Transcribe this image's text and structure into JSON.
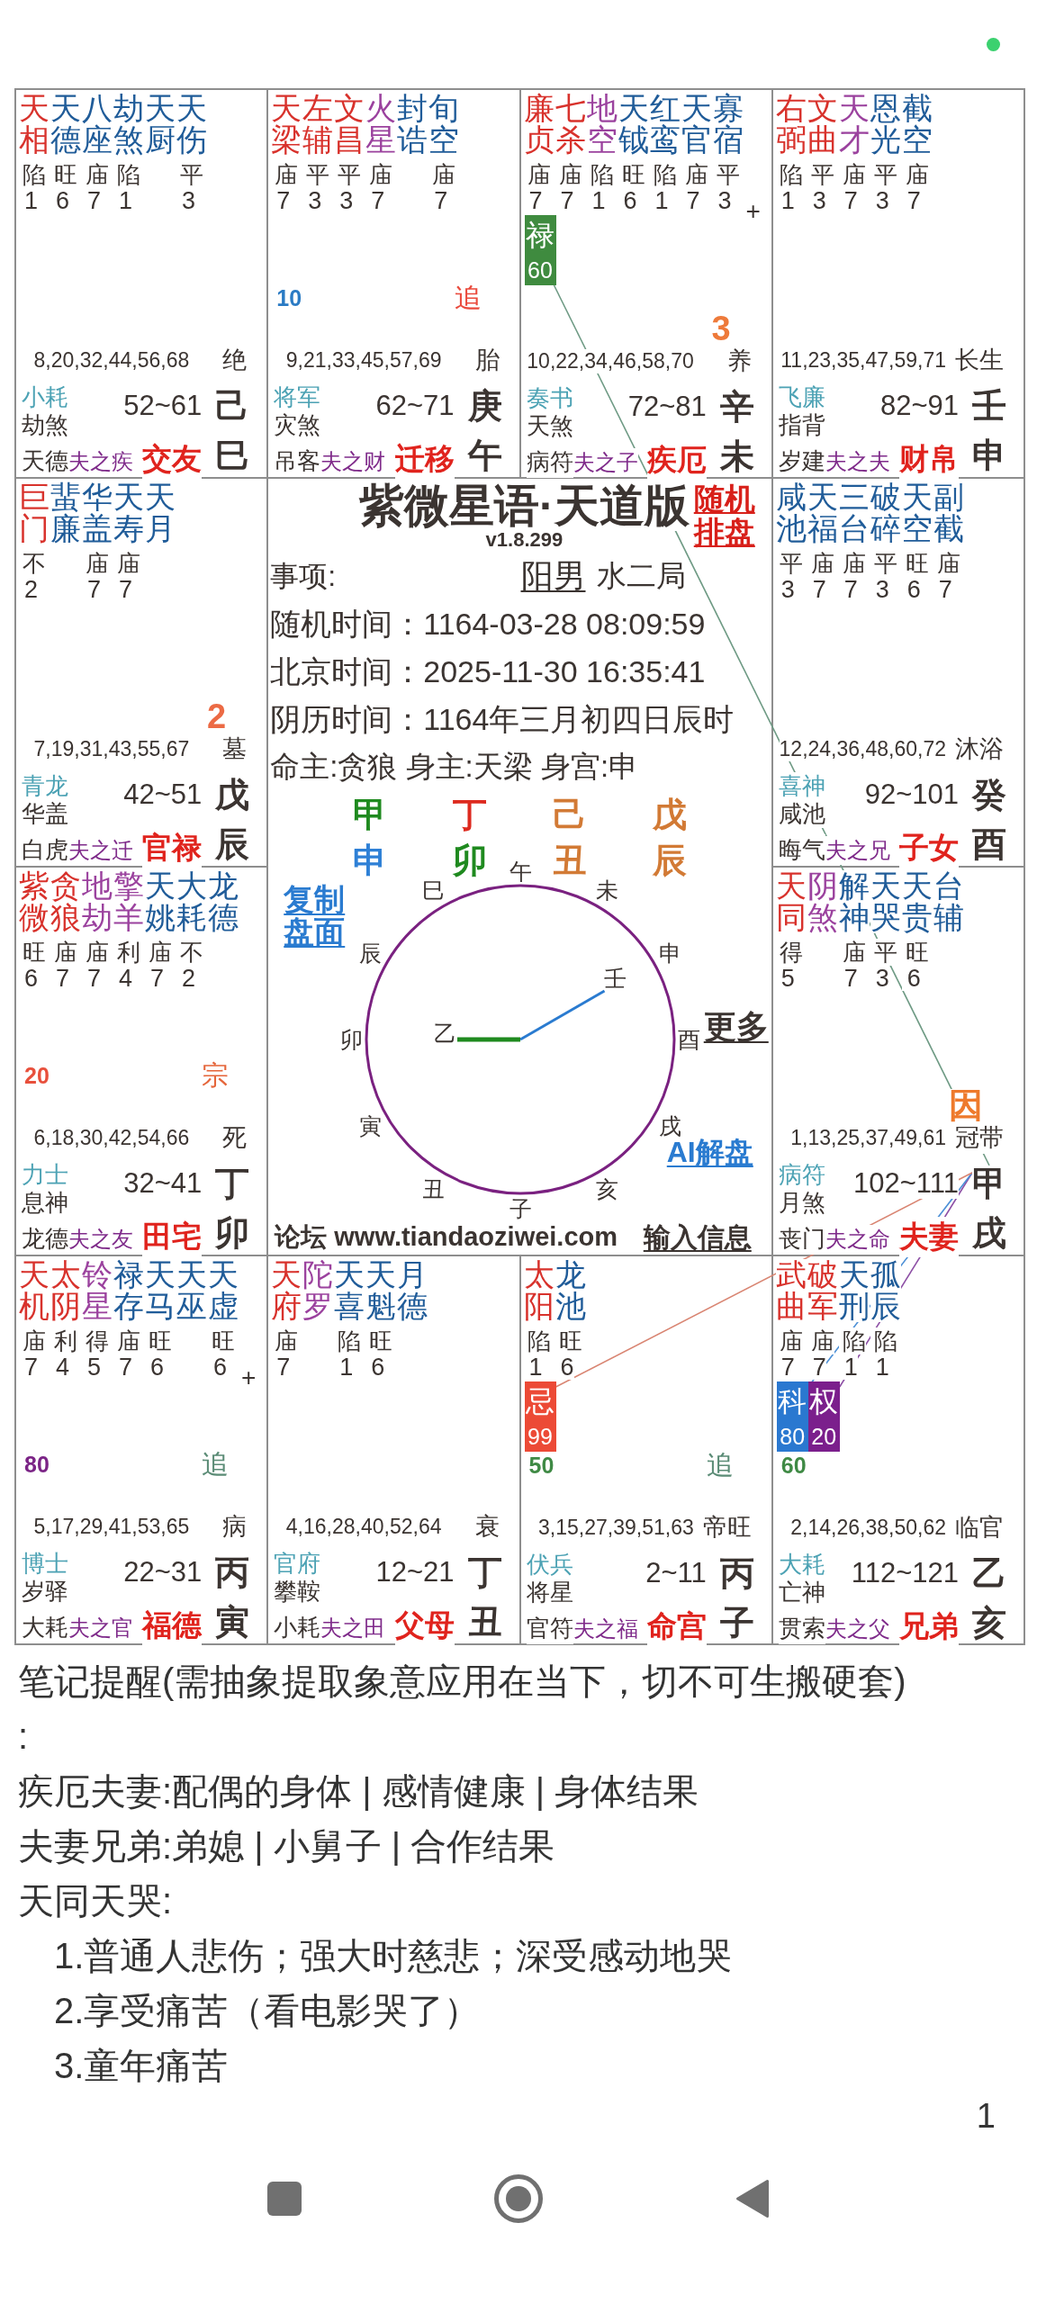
{
  "palaces": [
    {
      "stars": [
        {
          "name": "天相",
          "kind": "major",
          "brightness": "陷",
          "score": "1"
        },
        {
          "name": "天德",
          "kind": "minor",
          "brightness": "旺",
          "score": "6"
        },
        {
          "name": "八座",
          "kind": "minor",
          "brightness": "庙",
          "score": "7"
        },
        {
          "name": "劫煞",
          "kind": "minor",
          "brightness": "陷",
          "score": "1"
        },
        {
          "name": "天厨",
          "kind": "minor"
        },
        {
          "name": "天伤",
          "kind": "minor",
          "brightness": "平",
          "score": "3"
        }
      ],
      "ages": "8,20,32,44,56,68",
      "stage": "绝",
      "boshi": "小耗",
      "jiangqian": "劫煞",
      "suiqian": "天德",
      "relation": "夫之疾",
      "name": "交友",
      "range": "52~61",
      "stem": "己",
      "branch": "巳"
    },
    {
      "stars": [
        {
          "name": "天梁",
          "kind": "major",
          "brightness": "庙",
          "score": "7"
        },
        {
          "name": "左辅",
          "kind": "major",
          "brightness": "平",
          "score": "3"
        },
        {
          "name": "文昌",
          "kind": "major",
          "brightness": "平",
          "score": "3"
        },
        {
          "name": "火星",
          "kind": "malefic",
          "brightness": "庙",
          "score": "7"
        },
        {
          "name": "封诰",
          "kind": "minor"
        },
        {
          "name": "旬空",
          "kind": "minor",
          "brightness": "庙",
          "score": "7"
        }
      ],
      "count": {
        "text": "10",
        "color": "#2b7bc4"
      },
      "tag": {
        "text": "追",
        "color": "#ea4a3c"
      },
      "ages": "9,21,33,45,57,69",
      "stage": "胎",
      "boshi": "将军",
      "jiangqian": "灾煞",
      "suiqian": "吊客",
      "relation": "夫之财",
      "name": "迁移",
      "range": "62~71",
      "stem": "庚",
      "branch": "午"
    },
    {
      "stars": [
        {
          "name": "廉贞",
          "kind": "major",
          "brightness": "庙",
          "score": "7"
        },
        {
          "name": "七杀",
          "kind": "major",
          "brightness": "庙",
          "score": "7"
        },
        {
          "name": "地空",
          "kind": "malefic",
          "brightness": "陷",
          "score": "1"
        },
        {
          "name": "天钺",
          "kind": "minor",
          "brightness": "旺",
          "score": "6"
        },
        {
          "name": "红鸾",
          "kind": "minor",
          "brightness": "陷",
          "score": "1"
        },
        {
          "name": "天官",
          "kind": "minor",
          "brightness": "庙",
          "score": "7"
        },
        {
          "name": "寡宿",
          "kind": "minor",
          "brightness": "平",
          "score": "3"
        }
      ],
      "plus_mark": "+",
      "sihua": [
        {
          "label": "禄",
          "value": "60",
          "kind": "lu"
        }
      ],
      "big": {
        "text": "3",
        "color": "#ee7a3a"
      },
      "ages": "10,22,34,46,58,70",
      "stage": "养",
      "boshi": "奏书",
      "jiangqian": "天煞",
      "suiqian": "病符",
      "relation": "夫之子",
      "name": "疾厄",
      "range": "72~81",
      "stem": "辛",
      "branch": "未"
    },
    {
      "stars": [
        {
          "name": "右弼",
          "kind": "major",
          "brightness": "陷",
          "score": "1"
        },
        {
          "name": "文曲",
          "kind": "major",
          "brightness": "平",
          "score": "3"
        },
        {
          "name": "天才",
          "kind": "malefic",
          "brightness": "庙",
          "score": "7"
        },
        {
          "name": "恩光",
          "kind": "minor",
          "brightness": "平",
          "score": "3"
        },
        {
          "name": "截空",
          "kind": "minor",
          "brightness": "庙",
          "score": "7"
        }
      ],
      "ages": "11,23,35,47,59,71",
      "stage": "长生",
      "boshi": "飞廉",
      "jiangqian": "指背",
      "suiqian": "岁建",
      "relation": "夫之夫",
      "name": "财帛",
      "range": "82~91",
      "stem": "壬",
      "branch": "申"
    },
    {
      "stars": [
        {
          "name": "巨门",
          "kind": "major",
          "brightness": "不",
          "score": "2"
        },
        {
          "name": "蜚廉",
          "kind": "minor"
        },
        {
          "name": "华盖",
          "kind": "minor",
          "brightness": "庙",
          "score": "7"
        },
        {
          "name": "天寿",
          "kind": "minor",
          "brightness": "庙",
          "score": "7"
        },
        {
          "name": "天月",
          "kind": "minor"
        }
      ],
      "big": {
        "text": "2",
        "color": "#ec6a44"
      },
      "ages": "7,19,31,43,55,67",
      "stage": "墓",
      "boshi": "青龙",
      "jiangqian": "华盖",
      "suiqian": "白虎",
      "relation": "夫之迁",
      "name": "官禄",
      "range": "42~51",
      "stem": "戊",
      "branch": "辰"
    },
    {
      "stars": [
        {
          "name": "咸池",
          "kind": "minor",
          "brightness": "平",
          "score": "3"
        },
        {
          "name": "天福",
          "kind": "minor",
          "brightness": "庙",
          "score": "7"
        },
        {
          "name": "三台",
          "kind": "minor",
          "brightness": "庙",
          "score": "7"
        },
        {
          "name": "破碎",
          "kind": "minor",
          "brightness": "平",
          "score": "3"
        },
        {
          "name": "天空",
          "kind": "minor",
          "brightness": "旺",
          "score": "6"
        },
        {
          "name": "副截",
          "kind": "minor",
          "brightness": "庙",
          "score": "7"
        }
      ],
      "ages": "12,24,36,48,60,72",
      "stage": "沐浴",
      "boshi": "喜神",
      "jiangqian": "咸池",
      "suiqian": "晦气",
      "relation": "夫之兄",
      "name": "子女",
      "range": "92~101",
      "stem": "癸",
      "branch": "酉"
    },
    {
      "stars": [
        {
          "name": "紫微",
          "kind": "major",
          "brightness": "旺",
          "score": "6"
        },
        {
          "name": "贪狼",
          "kind": "major",
          "brightness": "庙",
          "score": "7"
        },
        {
          "name": "地劫",
          "kind": "malefic",
          "brightness": "庙",
          "score": "7"
        },
        {
          "name": "擎羊",
          "kind": "malefic",
          "brightness": "利",
          "score": "4"
        },
        {
          "name": "天姚",
          "kind": "minor",
          "brightness": "庙",
          "score": "7"
        },
        {
          "name": "大耗",
          "kind": "minor",
          "brightness": "不",
          "score": "2"
        },
        {
          "name": "龙德",
          "kind": "minor"
        }
      ],
      "count": {
        "text": "20",
        "color": "#e8503c"
      },
      "tag": {
        "text": "宗",
        "color": "#e5653a"
      },
      "ages": "6,18,30,42,54,66",
      "stage": "死",
      "boshi": "力士",
      "jiangqian": "息神",
      "suiqian": "龙德",
      "relation": "夫之友",
      "name": "田宅",
      "range": "32~41",
      "stem": "丁",
      "branch": "卯"
    },
    {
      "stars": [
        {
          "name": "天同",
          "kind": "major",
          "brightness": "得",
          "score": "5"
        },
        {
          "name": "阴煞",
          "kind": "malefic"
        },
        {
          "name": "解神",
          "kind": "minor",
          "brightness": "庙",
          "score": "7"
        },
        {
          "name": "天哭",
          "kind": "minor",
          "brightness": "平",
          "score": "3"
        },
        {
          "name": "天贵",
          "kind": "minor",
          "brightness": "旺",
          "score": "6"
        },
        {
          "name": "台辅",
          "kind": "minor"
        }
      ],
      "big": {
        "text": "因",
        "color": "#ee7a2c"
      },
      "ages": "1,13,25,37,49,61",
      "stage": "冠带",
      "boshi": "病符",
      "jiangqian": "月煞",
      "suiqian": "丧门",
      "relation": "夫之命",
      "name": "夫妻",
      "range": "102~111",
      "stem": "甲",
      "branch": "戌",
      "flying": [
        {
          "kind": "lu"
        },
        {
          "kind": "quan"
        },
        {
          "kind": "ke"
        },
        {
          "kind": "ji"
        }
      ]
    },
    {
      "stars": [
        {
          "name": "天机",
          "kind": "major",
          "brightness": "庙",
          "score": "7"
        },
        {
          "name": "太阴",
          "kind": "major",
          "brightness": "利",
          "score": "4"
        },
        {
          "name": "铃星",
          "kind": "malefic",
          "brightness": "得",
          "score": "5"
        },
        {
          "name": "禄存",
          "kind": "minor",
          "brightness": "庙",
          "score": "7"
        },
        {
          "name": "天马",
          "kind": "minor",
          "brightness": "旺",
          "score": "6"
        },
        {
          "name": "天巫",
          "kind": "minor"
        },
        {
          "name": "天虚",
          "kind": "minor",
          "brightness": "旺",
          "score": "6"
        }
      ],
      "plus_mark": "+",
      "count": {
        "text": "80",
        "color": "#7b2486"
      },
      "tag": {
        "text": "追",
        "color": "#5b8c76"
      },
      "ages": "5,17,29,41,53,65",
      "stage": "病",
      "boshi": "博士",
      "jiangqian": "岁驿",
      "suiqian": "大耗",
      "relation": "夫之官",
      "name": "福德",
      "range": "22~31",
      "stem": "丙",
      "branch": "寅"
    },
    {
      "stars": [
        {
          "name": "天府",
          "kind": "major",
          "brightness": "庙",
          "score": "7"
        },
        {
          "name": "陀罗",
          "kind": "malefic"
        },
        {
          "name": "天喜",
          "kind": "minor",
          "brightness": "陷",
          "score": "1"
        },
        {
          "name": "天魁",
          "kind": "minor",
          "brightness": "旺",
          "score": "6"
        },
        {
          "name": "月德",
          "kind": "minor"
        }
      ],
      "ages": "4,16,28,40,52,64",
      "stage": "衰",
      "boshi": "官府",
      "jiangqian": "攀鞍",
      "suiqian": "小耗",
      "relation": "夫之田",
      "name": "父母",
      "range": "12~21",
      "stem": "丁",
      "branch": "丑"
    },
    {
      "stars": [
        {
          "name": "太阳",
          "kind": "major",
          "brightness": "陷",
          "score": "1"
        },
        {
          "name": "龙池",
          "kind": "minor",
          "brightness": "旺",
          "score": "6"
        }
      ],
      "sihua": [
        {
          "label": "忌",
          "value": "99",
          "kind": "ji"
        }
      ],
      "count": {
        "text": "50",
        "color": "#3f8a45"
      },
      "tag": {
        "text": "追",
        "color": "#5b8c76"
      },
      "ages": "3,15,27,39,51,63",
      "stage": "帝旺",
      "boshi": "伏兵",
      "jiangqian": "将星",
      "suiqian": "官符",
      "relation": "夫之福",
      "name": "命宫",
      "range": "2~11",
      "stem": "丙",
      "branch": "子"
    },
    {
      "stars": [
        {
          "name": "武曲",
          "kind": "major",
          "brightness": "庙",
          "score": "7"
        },
        {
          "name": "破军",
          "kind": "major",
          "brightness": "庙",
          "score": "7"
        },
        {
          "name": "天刑",
          "kind": "minor",
          "brightness": "陷",
          "score": "1"
        },
        {
          "name": "孤辰",
          "kind": "minor",
          "brightness": "陷",
          "score": "1"
        }
      ],
      "sihua": [
        {
          "label": "科",
          "value": "80",
          "kind": "ke"
        },
        {
          "label": "权",
          "value": "20",
          "kind": "quan"
        }
      ],
      "count": {
        "text": "60",
        "color": "#3f8a45"
      },
      "ages": "2,14,26,38,50,62",
      "stage": "临官",
      "boshi": "大耗",
      "jiangqian": "亡神",
      "suiqian": "贯索",
      "relation": "夫之父",
      "name": "兄弟",
      "range": "112~121",
      "stem": "乙",
      "branch": "亥"
    }
  ],
  "center": {
    "title": "紫微星语·天道版",
    "version": "v1.8.299",
    "random_link": "随机排盘",
    "matter_label": "事项:",
    "gender": "阳男",
    "bureau": "水二局",
    "times": [
      "随机时间：1164-03-28 08:09:59",
      "北京时间：2025-11-30 16:35:41",
      "阴历时间：1164年三月初四日辰时"
    ],
    "masters": "命主:贪狼 身主:天梁 身宫:申",
    "pillars": [
      {
        "stem": {
          "text": "甲",
          "color": "#1f8a1f"
        },
        "branch": {
          "text": "申",
          "color": "#2e80d6"
        }
      },
      {
        "stem": {
          "text": "丁",
          "color": "#dd2a1f"
        },
        "branch": {
          "text": "卯",
          "color": "#1f8a1f"
        }
      },
      {
        "stem": {
          "text": "己",
          "color": "#d27a35"
        },
        "branch": {
          "text": "丑",
          "color": "#d27a35"
        }
      },
      {
        "stem": {
          "text": "戊",
          "color": "#d27a35"
        },
        "branch": {
          "text": "辰",
          "color": "#d27a35"
        }
      }
    ],
    "dial": {
      "branches": [
        {
          "label": "午"
        },
        {
          "label": "巳"
        },
        {
          "label": "未"
        },
        {
          "label": "辰"
        },
        {
          "label": "申",
          "hand": {
            "label": "壬",
            "kind": "minute",
            "color": "#2a7bd0"
          }
        },
        {
          "label": "卯",
          "hand": {
            "label": "乙",
            "kind": "hour",
            "color": "#1f8a1f"
          }
        },
        {
          "label": "酉"
        },
        {
          "label": "寅"
        },
        {
          "label": "戌"
        },
        {
          "label": "丑"
        },
        {
          "label": "亥"
        },
        {
          "label": "子"
        }
      ]
    },
    "left_links": [
      {
        "label": "复制盘面",
        "color": "#2a7bd0"
      }
    ],
    "right_links": [
      {
        "label": "更多",
        "color": "#3b3431"
      },
      {
        "label": "AI解盘",
        "color": "#2a7bd0"
      }
    ],
    "forum": "论坛 www.tiandaoziwei.com",
    "input_link": "输入信息"
  },
  "notes": [
    {
      "text": "笔记提醒(需抽象提取象意应用在当下，切不可生搬硬套)"
    },
    {
      "text": ":"
    },
    {
      "text": "疾厄夫妻:配偶的身体 | 感情健康 | 身体结果"
    },
    {
      "text": "夫妻兄弟:弟媳 | 小舅子 | 合作结果"
    },
    {
      "text": "天同天哭:",
      "children": [
        {
          "text": "1.普通人悲伤；强大时慈悲；深受感动地哭"
        },
        {
          "text": "2.享受痛苦（看电影哭了）"
        },
        {
          "text": "3.童年痛苦"
        }
      ]
    }
  ],
  "page_number": "1"
}
